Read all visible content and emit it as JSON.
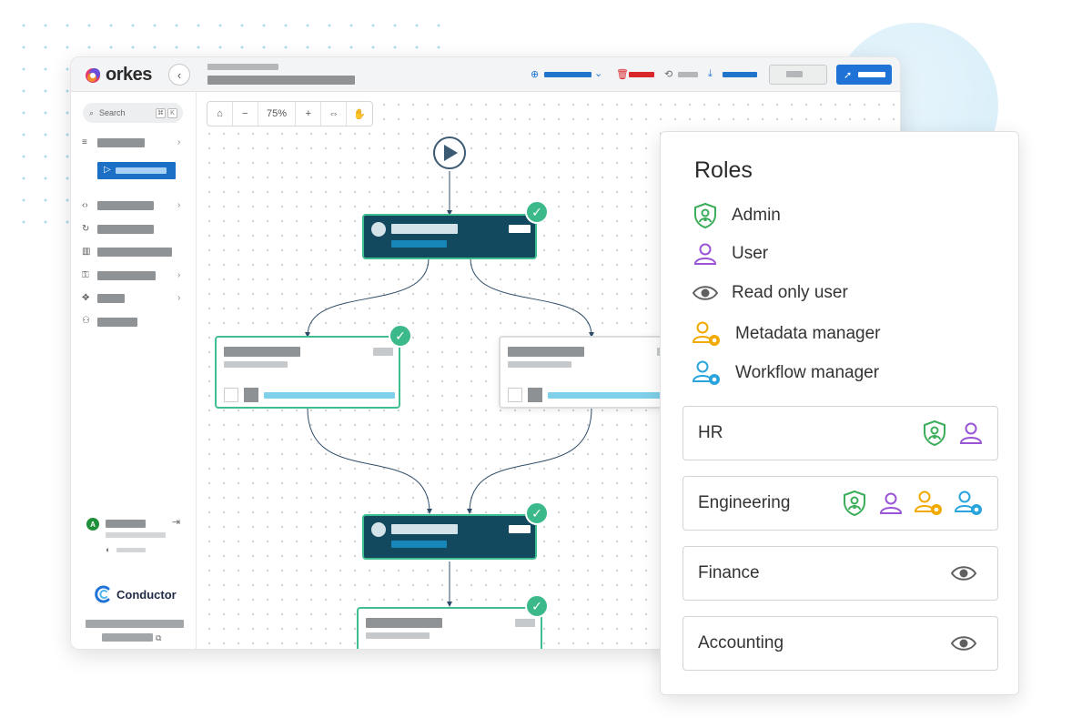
{
  "app": {
    "brand": "orkes",
    "product": "Conductor",
    "sidebar": {
      "search_placeholder": "Search",
      "avatar_initial": "A"
    },
    "zoom": "75%"
  },
  "roles_panel": {
    "title": "Roles",
    "roles": [
      {
        "label": "Admin",
        "icon": "admin-shield-icon"
      },
      {
        "label": "User",
        "icon": "user-icon"
      },
      {
        "label": "Read only user",
        "icon": "eye-icon"
      },
      {
        "label": "Metadata manager",
        "icon": "metadata-manager-icon"
      },
      {
        "label": "Workflow manager",
        "icon": "workflow-manager-icon"
      }
    ],
    "groups": [
      {
        "name": "HR",
        "roles": [
          "admin",
          "user"
        ]
      },
      {
        "name": "Engineering",
        "roles": [
          "admin",
          "user",
          "metadata",
          "workflow"
        ]
      },
      {
        "name": "Finance",
        "roles": [
          "readonly"
        ]
      },
      {
        "name": "Accounting",
        "roles": [
          "readonly"
        ]
      }
    ]
  },
  "colors": {
    "admin": "#3cad5a",
    "user": "#9a55d6",
    "readonly": "#5f5f5f",
    "metadata": "#f2a900",
    "workflow": "#2aa4dc",
    "node_dark": "#12495e",
    "node_border": "#3fbf8f",
    "primary": "#1f73d6"
  }
}
